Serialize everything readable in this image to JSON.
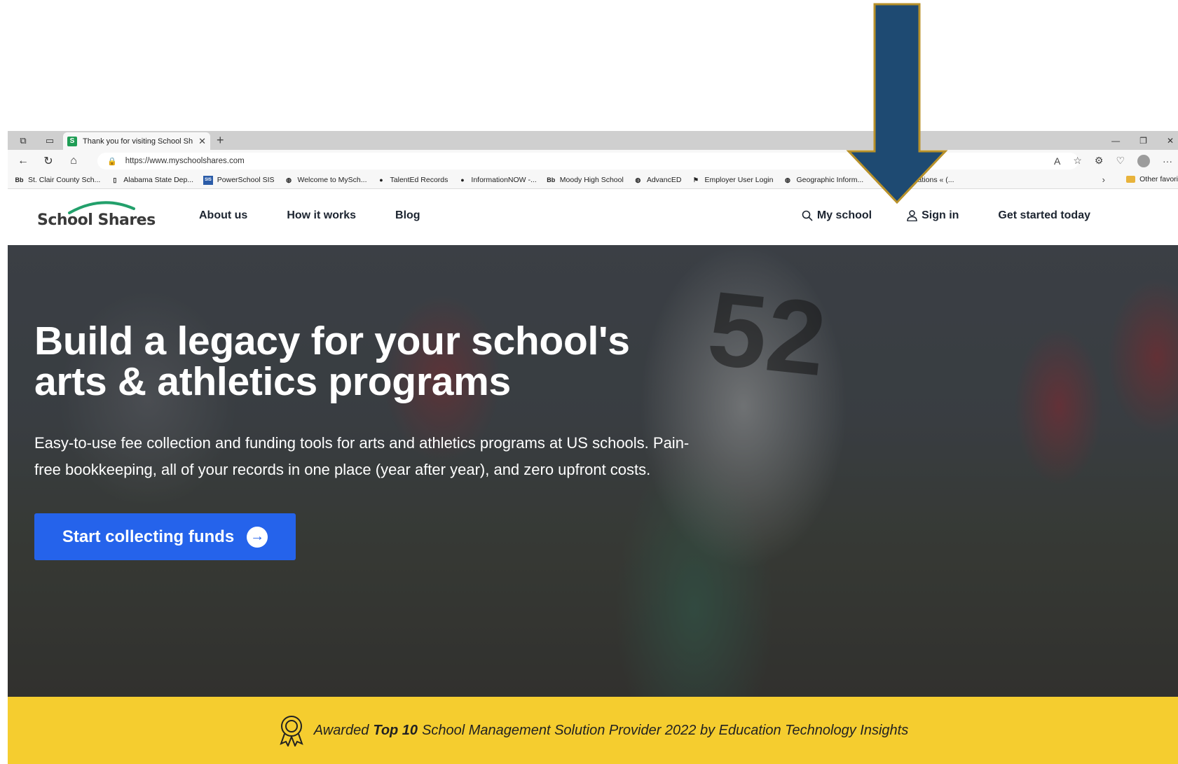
{
  "browser": {
    "tab_title": "Thank you for visiting School Sh",
    "tab_favicon": "S",
    "url": "https://www.myschoolshares.com",
    "bookmarks": [
      {
        "icon": "Bb",
        "label": "St. Clair County Sch..."
      },
      {
        "icon": "page-icon",
        "label": "Alabama State Dep..."
      },
      {
        "icon": "SIS",
        "label": "PowerSchool SIS"
      },
      {
        "icon": "globe-icon",
        "label": "Welcome to MySch..."
      },
      {
        "icon": "circle-icon",
        "label": "TalentEd Records"
      },
      {
        "icon": "circle-icon",
        "label": "InformationNOW -..."
      },
      {
        "icon": "Bb",
        "label": "Moody High School"
      },
      {
        "icon": "globe-icon",
        "label": "AdvancED"
      },
      {
        "icon": "flag-icon",
        "label": "Employer User Login"
      },
      {
        "icon": "globe-icon",
        "label": "Geographic Inform..."
      },
      {
        "icon": "circle-icon",
        "label": "My applications « (..."
      }
    ],
    "other_favorites": "Other favori"
  },
  "header": {
    "logo_text": "School Shares",
    "nav": [
      "About us",
      "How it works",
      "Blog"
    ],
    "my_school": "My school",
    "sign_in": "Sign in",
    "get_started": "Get started today"
  },
  "hero": {
    "title_line1": "Build a legacy for your school's",
    "title_line2": "arts & athletics programs",
    "subtitle": "Easy-to-use fee collection and funding tools for arts and athletics programs at US schools. Pain-free bookkeeping, all of your records in one place (year after year), and zero upfront costs.",
    "cta_label": "Start collecting funds",
    "background_number": "52"
  },
  "award": {
    "prefix": "Awarded",
    "highlight": "Top 10",
    "suffix": "School Management Solution Provider 2022 by Education Technology Insights"
  },
  "colors": {
    "accent_blue": "#2563eb",
    "award_yellow": "#f5cd2f",
    "annotation_arrow": "#1e4a72",
    "annotation_outline": "#b8912a",
    "logo_green": "#22a06b"
  },
  "annotation": {
    "icon": "down-arrow-annotation",
    "points_to": "My school"
  }
}
